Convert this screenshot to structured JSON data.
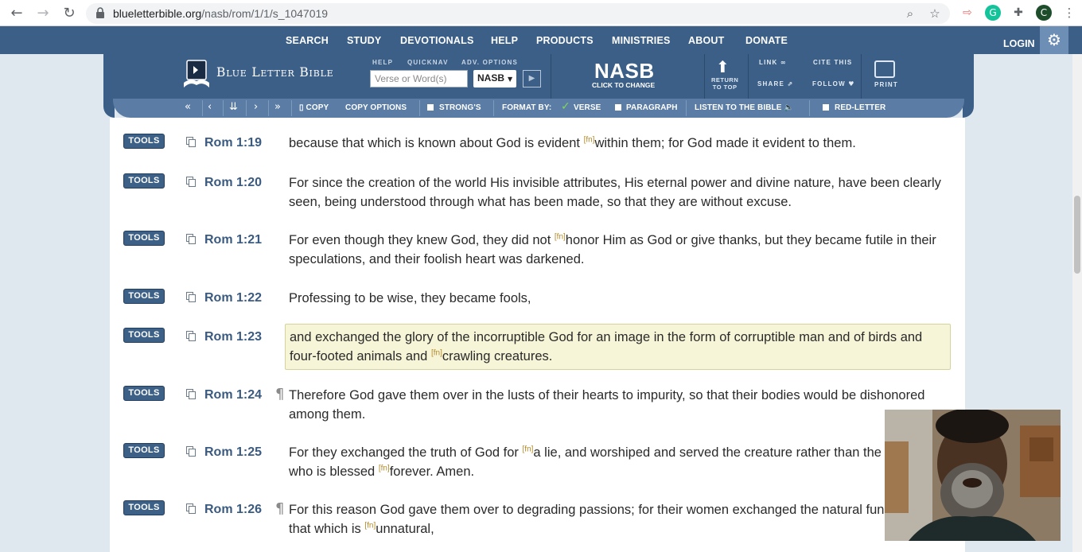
{
  "browser": {
    "url_host": "blueletterbible.org",
    "url_path": "/nasb/rom/1/1/s_1047019"
  },
  "site_nav": {
    "items": [
      "SEARCH",
      "STUDY",
      "DEVOTIONALS",
      "HELP",
      "PRODUCTS",
      "MINISTRIES",
      "ABOUT",
      "DONATE"
    ],
    "login": "LOGIN"
  },
  "toolbar": {
    "logo": "Blue Letter Bible",
    "help": "HELP",
    "quicknav": "QUICKNAV",
    "adv_options": "ADV. OPTIONS",
    "search_placeholder": "Verse or Word(s)",
    "version": "NASB",
    "version_big": "NASB",
    "version_sub": "CLICK TO CHANGE",
    "return_top_1": "RETURN",
    "return_top_2": "TO TOP",
    "link": "LINK",
    "cite": "CITE THIS",
    "share": "SHARE",
    "follow": "FOLLOW",
    "print": "PRINT"
  },
  "subbar": {
    "copy": "COPY",
    "copy_options": "COPY OPTIONS",
    "strongs": "STRONG'S",
    "format_by": "FORMAT BY:",
    "verse": "VERSE",
    "paragraph": "PARAGRAPH",
    "listen": "LISTEN TO THE BIBLE",
    "red_letter": "RED-LETTER"
  },
  "tools_label": "TOOLS",
  "verses": [
    {
      "ref": "Rom 1:19",
      "pilcrow": false,
      "parts": [
        "because that which is known about God is evident ",
        "within them; for God made it evident to them."
      ]
    },
    {
      "ref": "Rom 1:20",
      "pilcrow": false,
      "parts": [
        "For since the creation of the world His invisible attributes, His eternal power and divine nature, have been clearly seen, being understood through what has been made, so that they are without excuse."
      ]
    },
    {
      "ref": "Rom 1:21",
      "pilcrow": false,
      "parts": [
        "For even though they knew God, they did not ",
        "honor Him as God or give thanks, but they became futile in their speculations, and their foolish heart was darkened."
      ]
    },
    {
      "ref": "Rom 1:22",
      "pilcrow": false,
      "parts": [
        "Professing to be wise, they became fools,"
      ]
    },
    {
      "ref": "Rom 1:23",
      "pilcrow": false,
      "highlight": true,
      "parts": [
        "and exchanged the glory of the incorruptible God for an image in the form of corruptible man and of birds and four-footed animals and ",
        "crawling creatures."
      ]
    },
    {
      "ref": "Rom 1:24",
      "pilcrow": true,
      "parts": [
        "Therefore God gave them over in the lusts of their hearts to impurity, so that their bodies would be dishonored among them."
      ]
    },
    {
      "ref": "Rom 1:25",
      "pilcrow": false,
      "parts": [
        "For they exchanged the truth of God for ",
        "a lie, and worshiped and served the creature rather than the Creator, who is blessed ",
        "forever. Amen."
      ]
    },
    {
      "ref": "Rom 1:26",
      "pilcrow": true,
      "parts": [
        "For this reason God gave them over to degrading passions; for their women exchanged the natural function for that which is ",
        "unnatural,"
      ]
    }
  ],
  "footnote_marker": "[fn]",
  "pilcrow_char": "¶",
  "colors": {
    "nav_bg": "#3c5f87",
    "subbar_bg": "#5b7da5",
    "ref": "#3a5a80",
    "highlight": "#f7f5d8"
  }
}
